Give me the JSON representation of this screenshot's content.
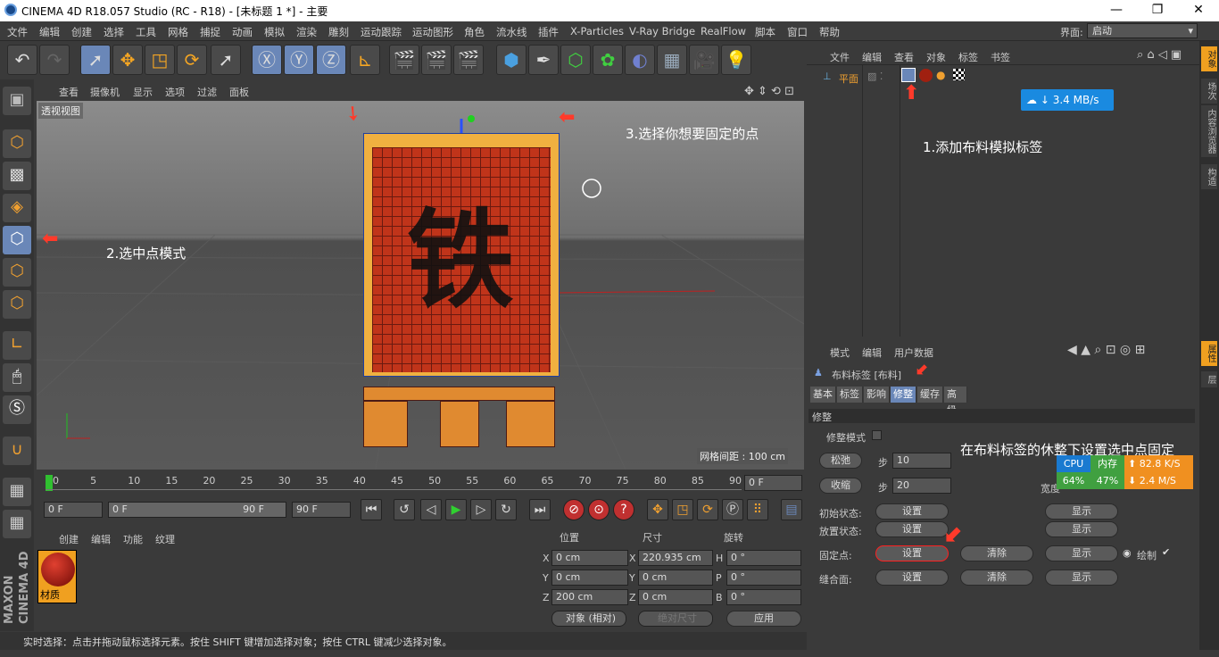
{
  "title": "CINEMA 4D R18.057 Studio (RC - R18) - [未标题 1 *] - 主要",
  "window_buttons": [
    "—",
    "❐",
    "✕"
  ],
  "menu": [
    "文件",
    "编辑",
    "创建",
    "选择",
    "工具",
    "网格",
    "捕捉",
    "动画",
    "模拟",
    "渲染",
    "雕刻",
    "运动跟踪",
    "运动图形",
    "角色",
    "流水线",
    "插件",
    "X-Particles",
    "V-Ray Bridge",
    "RealFlow",
    "脚本",
    "窗口",
    "帮助"
  ],
  "layout": {
    "label": "界面:",
    "value": "启动"
  },
  "viewport": {
    "menu": [
      "查看",
      "摄像机",
      "显示",
      "选项",
      "过滤",
      "面板"
    ],
    "label": "透视视图",
    "grid_spacing": "网格间距 : 100 cm",
    "flag_char": "铁"
  },
  "annotations": {
    "step1": "1.添加布料模拟标签",
    "step2": "2.选中点模式",
    "step3": "3.选择你想要固定的点",
    "step4": "在布料标签的休整下设置选中点固定"
  },
  "timeline": {
    "ticks": [
      "0",
      "5",
      "10",
      "15",
      "20",
      "25",
      "30",
      "35",
      "40",
      "45",
      "50",
      "55",
      "60",
      "65",
      "70",
      "75",
      "80",
      "85",
      "90"
    ],
    "current": "0 F",
    "start": "0 F",
    "range_start": "0 F",
    "range_end": "90 F",
    "end": "90 F"
  },
  "material_panel": {
    "menu": [
      "创建",
      "编辑",
      "功能",
      "纹理"
    ],
    "material_name": "材质"
  },
  "coord_panel": {
    "headers": [
      "位置",
      "尺寸",
      "旋转"
    ],
    "rows": [
      {
        "axis": "X",
        "pos": "0 cm",
        "size_axis": "X",
        "size": "220.935 cm",
        "rot_axis": "H",
        "rot": "0 °"
      },
      {
        "axis": "Y",
        "pos": "0 cm",
        "size_axis": "Y",
        "size": "0 cm",
        "rot_axis": "P",
        "rot": "0 °"
      },
      {
        "axis": "Z",
        "pos": "200 cm",
        "size_axis": "Z",
        "size": "0 cm",
        "rot_axis": "B",
        "rot": "0 °"
      }
    ],
    "mode": "对象 (相对)",
    "size_mode": "绝对尺寸",
    "apply": "应用"
  },
  "status": "实时选择：点击并拖动鼠标选择元素。按住 SHIFT 键增加选择对象；按住 CTRL 键减少选择对象。",
  "object_manager": {
    "menu": [
      "文件",
      "编辑",
      "查看",
      "对象",
      "标签",
      "书签"
    ],
    "object_name": "平面",
    "net_speed": "3.4 MB/s"
  },
  "attributes": {
    "menu": [
      "模式",
      "编辑",
      "用户数据"
    ],
    "tag_title": "布料标签 [布料]",
    "tabs": [
      "基本",
      "标签",
      "影响",
      "修整",
      "缓存",
      "高级"
    ],
    "active_tab": "修整",
    "section": "修整",
    "dress_mode": "修整模式",
    "relax_btn": "松弛",
    "relax_step_label": "步",
    "relax_step": "10",
    "shrink_btn": "收缩",
    "shrink_step_label": "步",
    "shrink_step": "20",
    "width_label": "宽度",
    "initial_state": "初始状态:",
    "place_state": "放置状态:",
    "fix_points": "固定点:",
    "seam": "缝合面:",
    "set": "设置",
    "clear": "清除",
    "show": "显示",
    "draw": "绘制"
  },
  "monitor": {
    "cpu_label": "CPU",
    "mem_label": "内存",
    "cpu": "64%",
    "mem": "47%",
    "up": "82.8 K/S",
    "down": "2.4 M/S"
  },
  "right_tabs": [
    "对象",
    "场次",
    "内容浏览器",
    "构造",
    "属性",
    "层"
  ],
  "brand": "MAXON CINEMA 4D"
}
